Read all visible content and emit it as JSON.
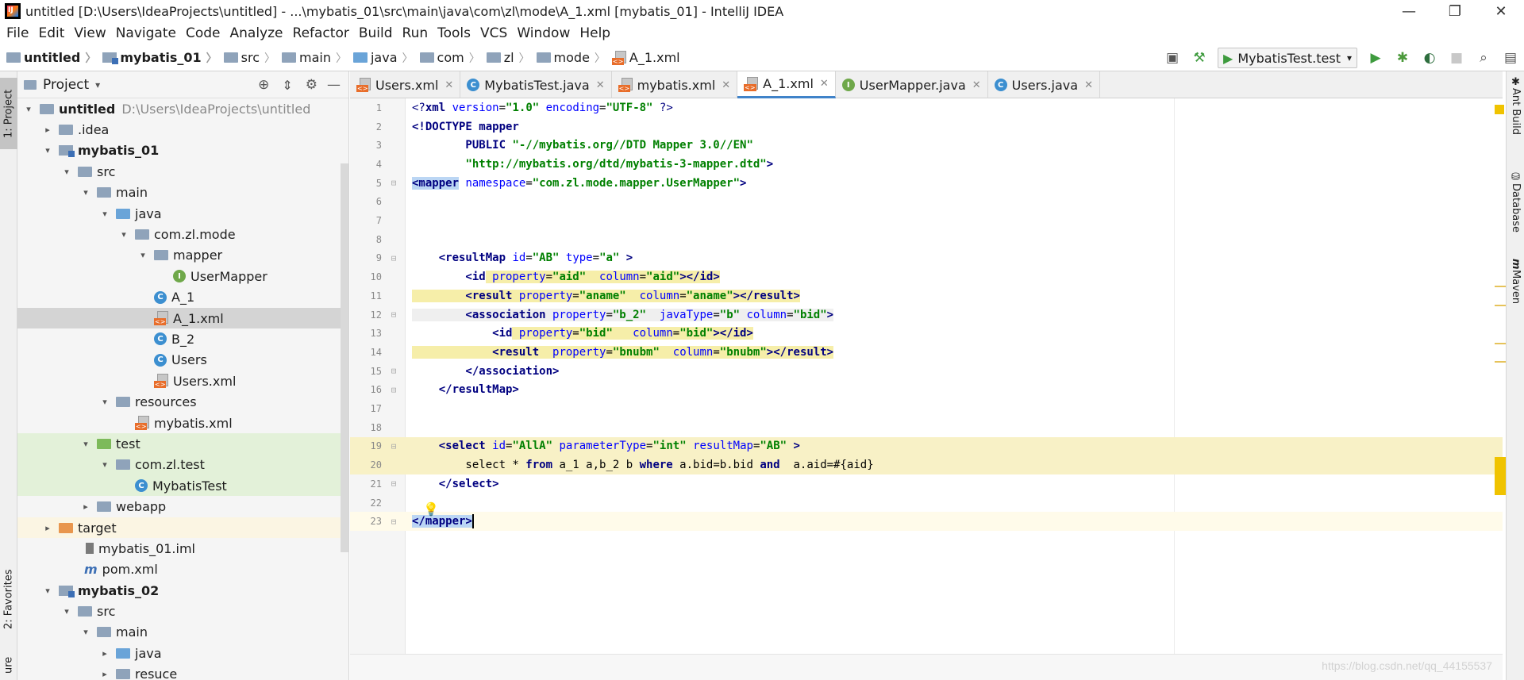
{
  "window": {
    "title": "untitled [D:\\Users\\IdeaProjects\\untitled] - ...\\mybatis_01\\src\\main\\java\\com\\zl\\mode\\A_1.xml [mybatis_01] - IntelliJ IDEA",
    "minimize": "—",
    "restore": "❐",
    "close": "✕"
  },
  "menu": [
    "File",
    "Edit",
    "View",
    "Navigate",
    "Code",
    "Analyze",
    "Refactor",
    "Build",
    "Run",
    "Tools",
    "VCS",
    "Window",
    "Help"
  ],
  "breadcrumbs": [
    "untitled",
    "mybatis_01",
    "src",
    "main",
    "java",
    "com",
    "zl",
    "mode",
    "A_1.xml"
  ],
  "toolbar": {
    "run_config": "MybatisTest.test"
  },
  "left_strip": {
    "project_tab": "1: Project",
    "favorites_tab": "2: Favorites",
    "structure_tab": "ure"
  },
  "project_panel": {
    "title": "Project",
    "tree": [
      {
        "label": "untitled",
        "hint": "D:\\Users\\IdeaProjects\\untitled"
      },
      {
        "label": ".idea"
      },
      {
        "label": "mybatis_01"
      },
      {
        "label": "src"
      },
      {
        "label": "main"
      },
      {
        "label": "java"
      },
      {
        "label": "com.zl.mode"
      },
      {
        "label": "mapper"
      },
      {
        "label": "UserMapper"
      },
      {
        "label": "A_1"
      },
      {
        "label": "A_1.xml"
      },
      {
        "label": "B_2"
      },
      {
        "label": "Users"
      },
      {
        "label": "Users.xml"
      },
      {
        "label": "resources"
      },
      {
        "label": "mybatis.xml"
      },
      {
        "label": "test"
      },
      {
        "label": "com.zl.test"
      },
      {
        "label": "MybatisTest"
      },
      {
        "label": "webapp"
      },
      {
        "label": "target"
      },
      {
        "label": "mybatis_01.iml"
      },
      {
        "label": "pom.xml"
      },
      {
        "label": "mybatis_02"
      },
      {
        "label": "src"
      },
      {
        "label": "main"
      },
      {
        "label": "java"
      },
      {
        "label": "resuce"
      }
    ]
  },
  "editor_tabs": [
    "Users.xml",
    "MybatisTest.java",
    "mybatis.xml",
    "A_1.xml",
    "UserMapper.java",
    "Users.java"
  ],
  "editor": {
    "line_numbers": [
      "1",
      "2",
      "3",
      "4",
      "5",
      "6",
      "7",
      "8",
      "9",
      "10",
      "11",
      "12",
      "13",
      "14",
      "15",
      "16",
      "17",
      "18",
      "19",
      "20",
      "21",
      "22",
      "23"
    ],
    "lines": {
      "l1_a": "<?",
      "l1_b": "xml ",
      "l1_c": "version",
      "l1_d": "=",
      "l1_e": "\"1.0\"",
      "l1_f": " encoding",
      "l1_g": "=",
      "l1_h": "\"UTF-8\"",
      "l1_i": " ?>",
      "l2": "<!DOCTYPE mapper",
      "l3_a": "        PUBLIC ",
      "l3_b": "\"-//mybatis.org//DTD Mapper 3.0//EN\"",
      "l4_a": "        ",
      "l4_b": "\"http://mybatis.org/dtd/mybatis-3-mapper.dtd\"",
      "l4_c": ">",
      "l5_a": "<mapper",
      "l5_b": " namespace",
      "l5_c": "=",
      "l5_d": "\"com.zl.mode.mapper.UserMapper\"",
      "l5_e": ">",
      "l9_a": "    <resultMap",
      "l9_b": " id",
      "l9_c": "=",
      "l9_d": "\"AB\"",
      "l9_e": " type",
      "l9_f": "=",
      "l9_g": "\"a\"",
      "l9_h": " >",
      "l10_a": "        <id",
      "l10_b": " property",
      "l10_c": "=",
      "l10_d": "\"aid\"",
      "l10_e": "  column",
      "l10_f": "=",
      "l10_g": "\"aid\"",
      "l10_h": "></id>",
      "l11_a": "        <result",
      "l11_b": " property",
      "l11_c": "=",
      "l11_d": "\"aname\"",
      "l11_e": "  column",
      "l11_f": "=",
      "l11_g": "\"aname\"",
      "l11_h": "></result>",
      "l12_a": "        <association",
      "l12_b": " property",
      "l12_c": "=",
      "l12_d": "\"b_2\"",
      "l12_e": "  javaType",
      "l12_f": "=",
      "l12_g": "\"b\"",
      "l12_h": " column",
      "l12_i": "=",
      "l12_j": "\"bid\"",
      "l12_k": ">",
      "l13_a": "            <id",
      "l13_b": " property",
      "l13_c": "=",
      "l13_d": "\"bid\"",
      "l13_e": "   column",
      "l13_f": "=",
      "l13_g": "\"bid\"",
      "l13_h": "></id>",
      "l14_a": "            <result",
      "l14_b": "  property",
      "l14_c": "=",
      "l14_d": "\"bnubm\"",
      "l14_e": "  column",
      "l14_f": "=",
      "l14_g": "\"bnubm\"",
      "l14_h": "></result>",
      "l15": "        </association>",
      "l16": "    </resultMap>",
      "l19_a": "    <select",
      "l19_b": " id",
      "l19_c": "=",
      "l19_d": "\"AllA\"",
      "l19_e": " parameterType",
      "l19_f": "=",
      "l19_g": "\"int\"",
      "l19_h": " resultMap",
      "l19_i": "=",
      "l19_j": "\"AB\"",
      "l19_k": " >",
      "l20_a": "        select * ",
      "l20_b": "from",
      "l20_c": " a_1 a,b_2 b ",
      "l20_d": "where",
      "l20_e": " a.bid=b.bid ",
      "l20_f": "and",
      "l20_g": "  a.aid=#{aid}",
      "l21": "    </select>",
      "l23": "</mapper>"
    }
  },
  "right_strip": {
    "ant_build": "Ant Build",
    "database": "Database",
    "maven": "Maven"
  },
  "watermark": "https://blog.csdn.net/qq_44155537",
  "colors": {
    "selection": "#bbd6f4",
    "highlight": "#f8f1c6",
    "tag": "#000080",
    "string": "#008000",
    "attribute": "#0000ff"
  }
}
